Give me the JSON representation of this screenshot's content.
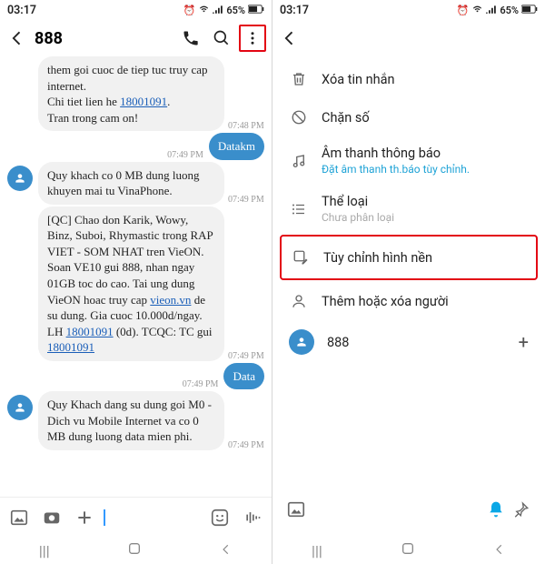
{
  "status": {
    "time": "03:17",
    "battery": "65%"
  },
  "left": {
    "title": "888",
    "msg1": "them goi cuoc de tiep tuc truy cap internet.\nChi tiet lien he ",
    "msg1_link": "18001091",
    "msg1_tail": ".\nTran trong cam on!",
    "ts1": "07:48 PM",
    "out1": "Datakm",
    "ts_out1": "07:49 PM",
    "msg2": "Quy khach co 0 MB dung luong khuyen mai tu VinaPhone.",
    "ts2": "07:49 PM",
    "msg3a": "[QC] Chao don Karik, Wowy, Binz, Suboi, Rhymastic trong RAP VIET - SOM NHAT tren VieON. Soan VE10 gui 888, nhan ngay 01GB toc do cao. Tai ung dung VieON hoac truy cap ",
    "msg3_link1": "vieon.vn",
    "msg3b": " de su dung. Gia cuoc 10.000d/ngay. LH ",
    "msg3_link2": "18001091",
    "msg3c": " (0d). TCQC: TC gui ",
    "msg3_link3": "18001091",
    "ts3": "07:49 PM",
    "out2": "Data",
    "ts_out2": "07:49 PM",
    "msg4": "Quy Khach dang su dung goi M0 - Dich vu Mobile Internet va co 0 MB dung luong data mien phi.",
    "ts4": "07:49 PM"
  },
  "right": {
    "items": [
      {
        "label": "Xóa tin nhắn"
      },
      {
        "label": "Chặn số"
      },
      {
        "label": "Âm thanh thông báo",
        "sub": "Đặt âm thanh th.báo tùy chỉnh."
      },
      {
        "label": "Thể loại",
        "sub": "Chưa phân loại"
      },
      {
        "label": "Tùy chỉnh hình nền"
      },
      {
        "label": "Thêm hoặc xóa người"
      }
    ],
    "contact": "888"
  }
}
